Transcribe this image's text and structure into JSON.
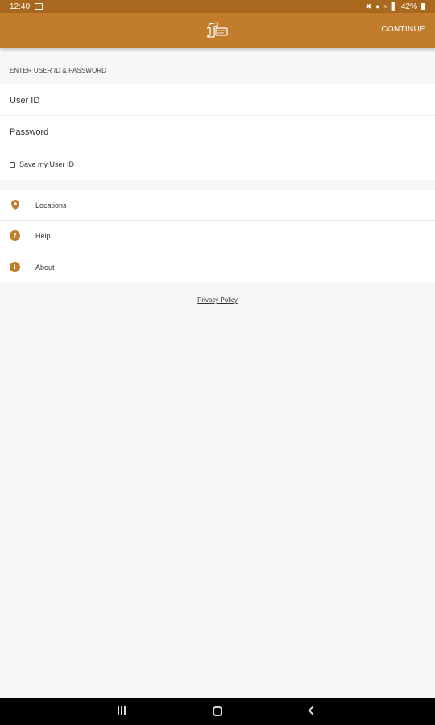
{
  "status_bar": {
    "time": "12:40",
    "battery": "42%",
    "icons": [
      "image-icon",
      "mute-icon",
      "location-icon",
      "wifi-icon",
      "signal-icon",
      "battery-icon"
    ]
  },
  "app_bar": {
    "logo_icon": "brand-logo",
    "continue_label": "CONTINUE",
    "color": "#c17c2c"
  },
  "login": {
    "section_heading": "ENTER USER ID & PASSWORD",
    "user_id_placeholder": "User ID",
    "password_placeholder": "Password",
    "save_user_label": "Save my User ID",
    "save_user_checked": false
  },
  "menu": {
    "items": [
      {
        "label": "Locations",
        "icon": "location-pin-icon"
      },
      {
        "label": "Help",
        "icon": "help-icon"
      },
      {
        "label": "About",
        "icon": "info-icon"
      }
    ]
  },
  "footer": {
    "privacy_label": "Privacy Policy"
  },
  "nav_bar": {
    "icons": [
      "recent-apps-icon",
      "home-icon",
      "back-icon"
    ]
  }
}
